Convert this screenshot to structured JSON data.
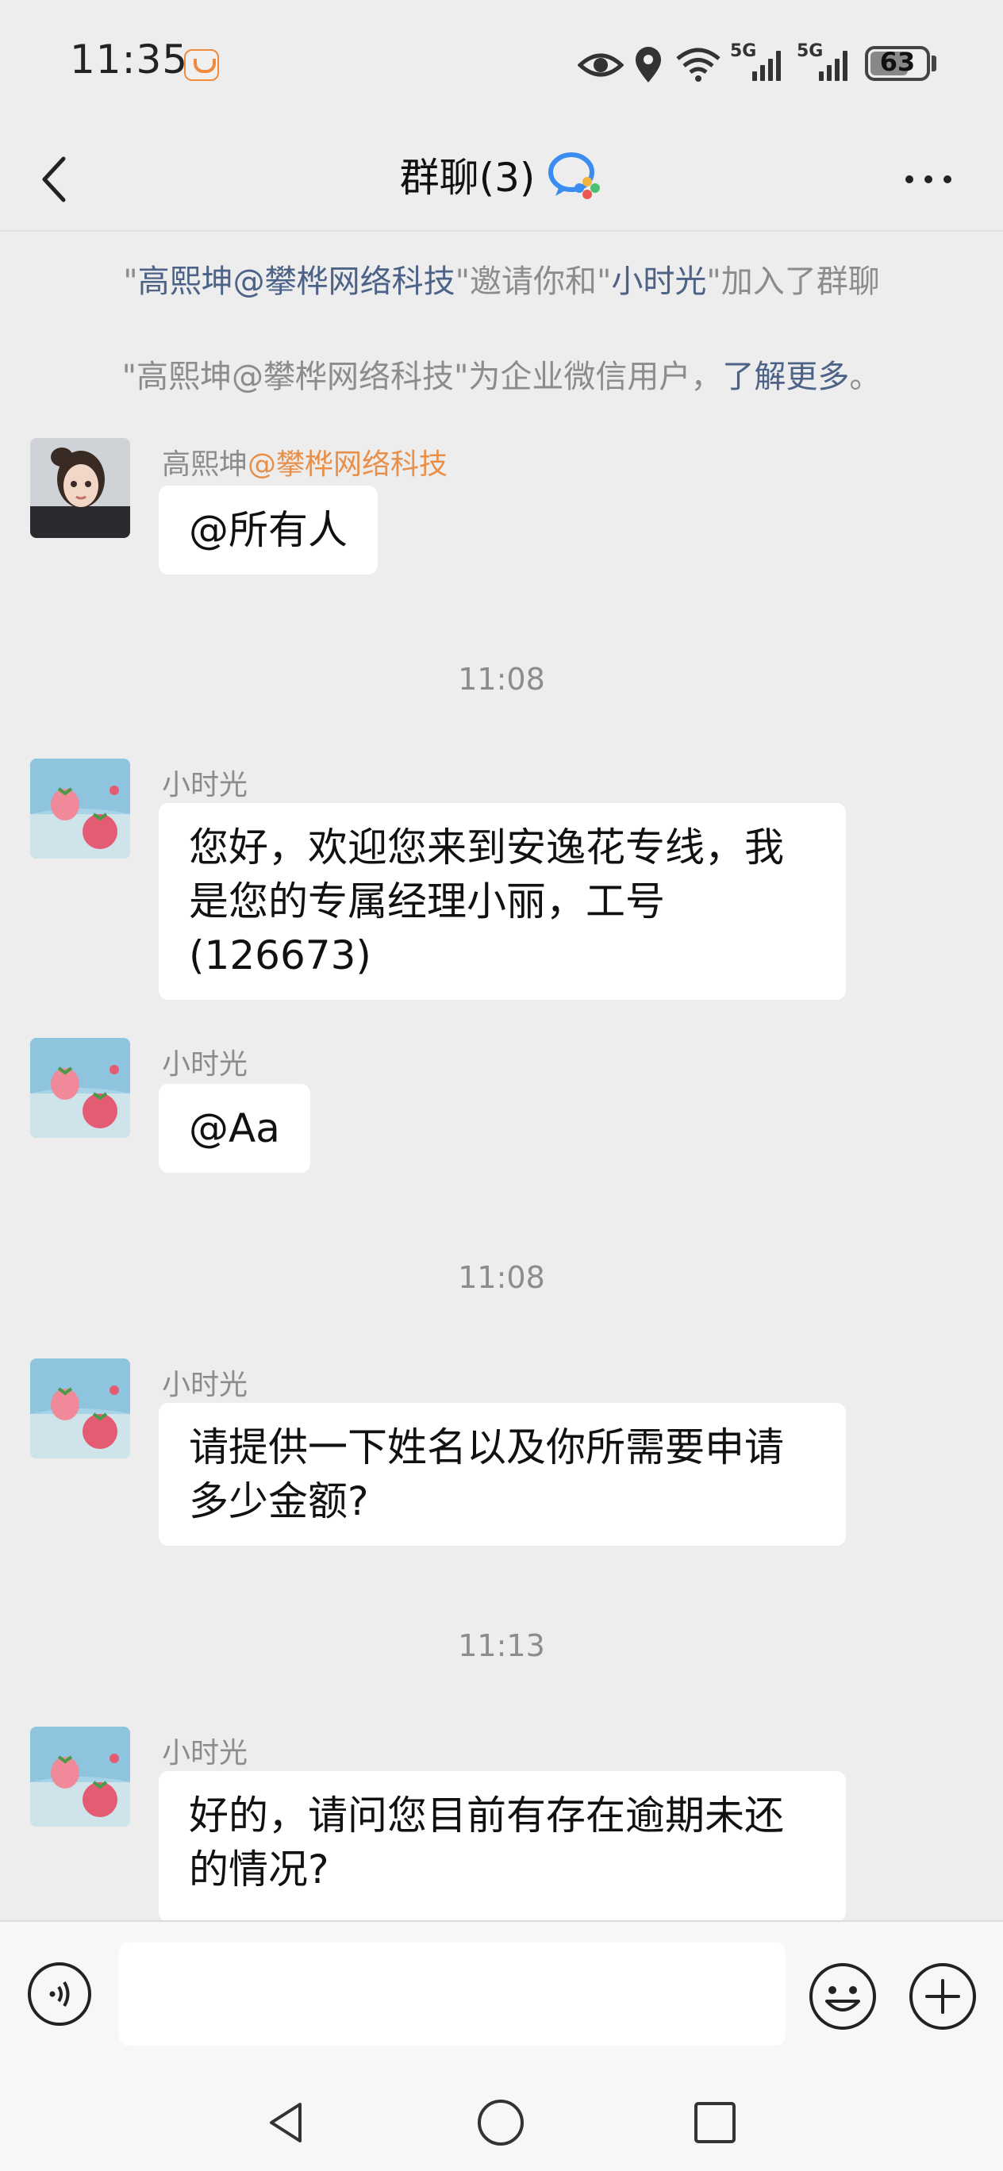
{
  "status_bar": {
    "time": "11:35",
    "signal_1": "5G",
    "signal_2": "5G",
    "battery": "63"
  },
  "header": {
    "title": "群聊(3)"
  },
  "system_messages": {
    "invite_prefix": "\"",
    "invite_inviter": "高熙坤@攀桦网络科技",
    "invite_mid": "\"邀请你和\"",
    "invite_invitee": "小时光",
    "invite_suffix": "\"加入了群聊",
    "wecom_text": "\"高熙坤@攀桦网络科技\"为企业微信用户，",
    "wecom_link": "了解更多",
    "wecom_end": "。"
  },
  "messages": [
    {
      "sender": "高熙坤",
      "sender_company": "@攀桦网络科技",
      "text": "@所有人"
    },
    {
      "time": "11:08"
    },
    {
      "sender": "小时光",
      "lines": [
        "您好，欢迎您来到安逸花专线，我",
        "是您的专属经理小丽，工号",
        "(126673)"
      ]
    },
    {
      "sender": "小时光",
      "text": "@Aa"
    },
    {
      "time": "11:08"
    },
    {
      "sender": "小时光",
      "lines": [
        "请提供一下姓名以及你所需要申请",
        "多少金额?"
      ]
    },
    {
      "time": "11:13"
    },
    {
      "sender": "小时光",
      "lines": [
        "好的，请问您目前有存在逾期未还",
        "的情况?"
      ]
    }
  ],
  "colors": {
    "background": "#ededed",
    "bubble": "#ffffff",
    "link": "#4d6287",
    "company": "#e8904a"
  }
}
